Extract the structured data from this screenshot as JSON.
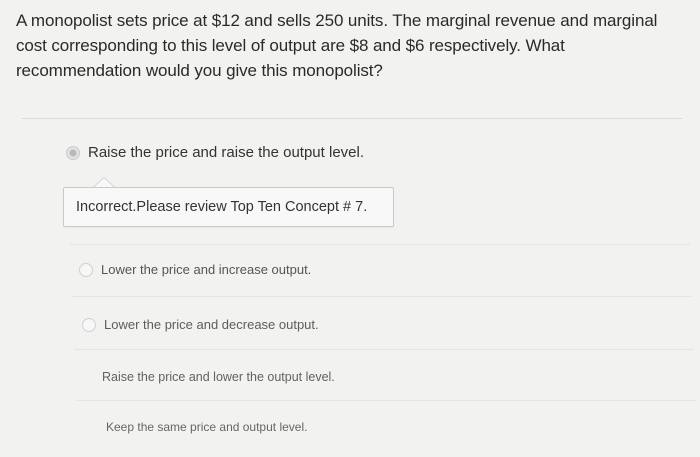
{
  "question": {
    "text": "A monopolist sets price at $12 and sells 250 units. The marginal revenue and marginal cost corresponding to this level of output are $8 and $6 respectively. What recommendation would you give this monopolist?"
  },
  "options": [
    {
      "label": "Raise the price and raise the output level.",
      "selected": true
    },
    {
      "label": "Lower the price and increase output.",
      "selected": false
    },
    {
      "label": "Lower the price and decrease output.",
      "selected": false
    },
    {
      "label": "Raise the price and lower the output level.",
      "selected": false
    },
    {
      "label": "Keep the same price and output level.",
      "selected": false
    }
  ],
  "feedback": {
    "text": "Incorrect.Please review Top Ten Concept # 7."
  }
}
